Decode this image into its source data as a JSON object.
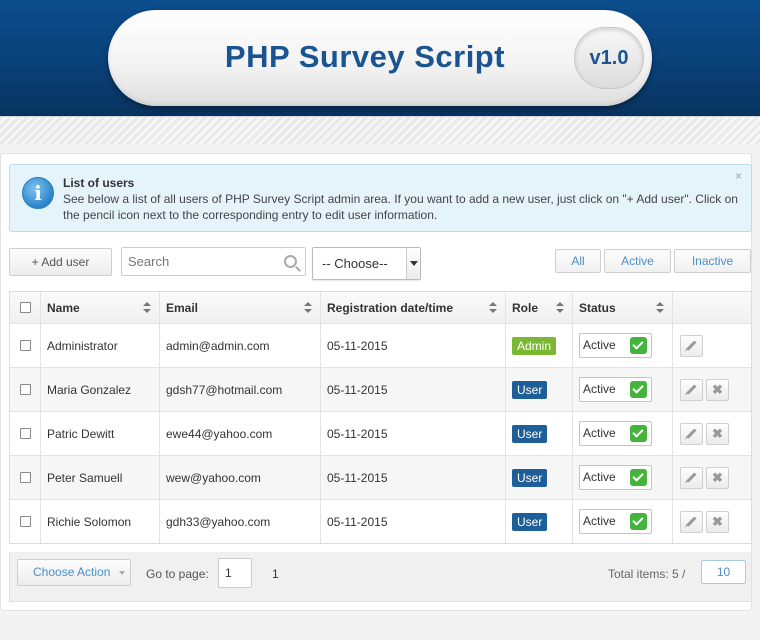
{
  "header": {
    "title": "PHP Survey Script",
    "version": "v1.0"
  },
  "info": {
    "title": "List of users",
    "text": "See below a list of all users of PHP Survey Script admin area. If you want to add a new user, just click on \"+ Add user\". Click on the pencil icon next to the corresponding entry to edit user information.",
    "close": "×"
  },
  "toolbar": {
    "add_label": "+ Add user",
    "search_placeholder": "Search",
    "choose": "-- Choose--",
    "filters": [
      "All",
      "Active",
      "Inactive"
    ]
  },
  "table": {
    "columns": [
      "Name",
      "Email",
      "Registration date/time",
      "Role",
      "Status"
    ],
    "rows": [
      {
        "name": "Administrator",
        "email": "admin@admin.com",
        "date": "05-11-2015",
        "role": "Admin",
        "status": "Active"
      },
      {
        "name": "Maria Gonzalez",
        "email": "gdsh77@hotmail.com",
        "date": "05-11-2015",
        "role": "User",
        "status": "Active"
      },
      {
        "name": "Patric Dewitt",
        "email": "ewe44@yahoo.com",
        "date": "05-11-2015",
        "role": "User",
        "status": "Active"
      },
      {
        "name": "Peter Samuell",
        "email": "wew@yahoo.com",
        "date": "05-11-2015",
        "role": "User",
        "status": "Active"
      },
      {
        "name": "Richie Solomon",
        "email": "gdh33@yahoo.com",
        "date": "05-11-2015",
        "role": "User",
        "status": "Active"
      }
    ],
    "delete_symbol": "✖"
  },
  "footer": {
    "choose_action": "Choose Action",
    "goto_label": "Go to page:",
    "goto_value": "1",
    "page_total": "1",
    "total_label": "Total items: 5 /",
    "per_page": "10"
  },
  "colors": {
    "header_blue": "#0b4d8c",
    "admin_badge": "#7ab833",
    "user_badge": "#1f5f99",
    "status_ok": "#46b33c",
    "link_blue": "#4a8fc9"
  }
}
